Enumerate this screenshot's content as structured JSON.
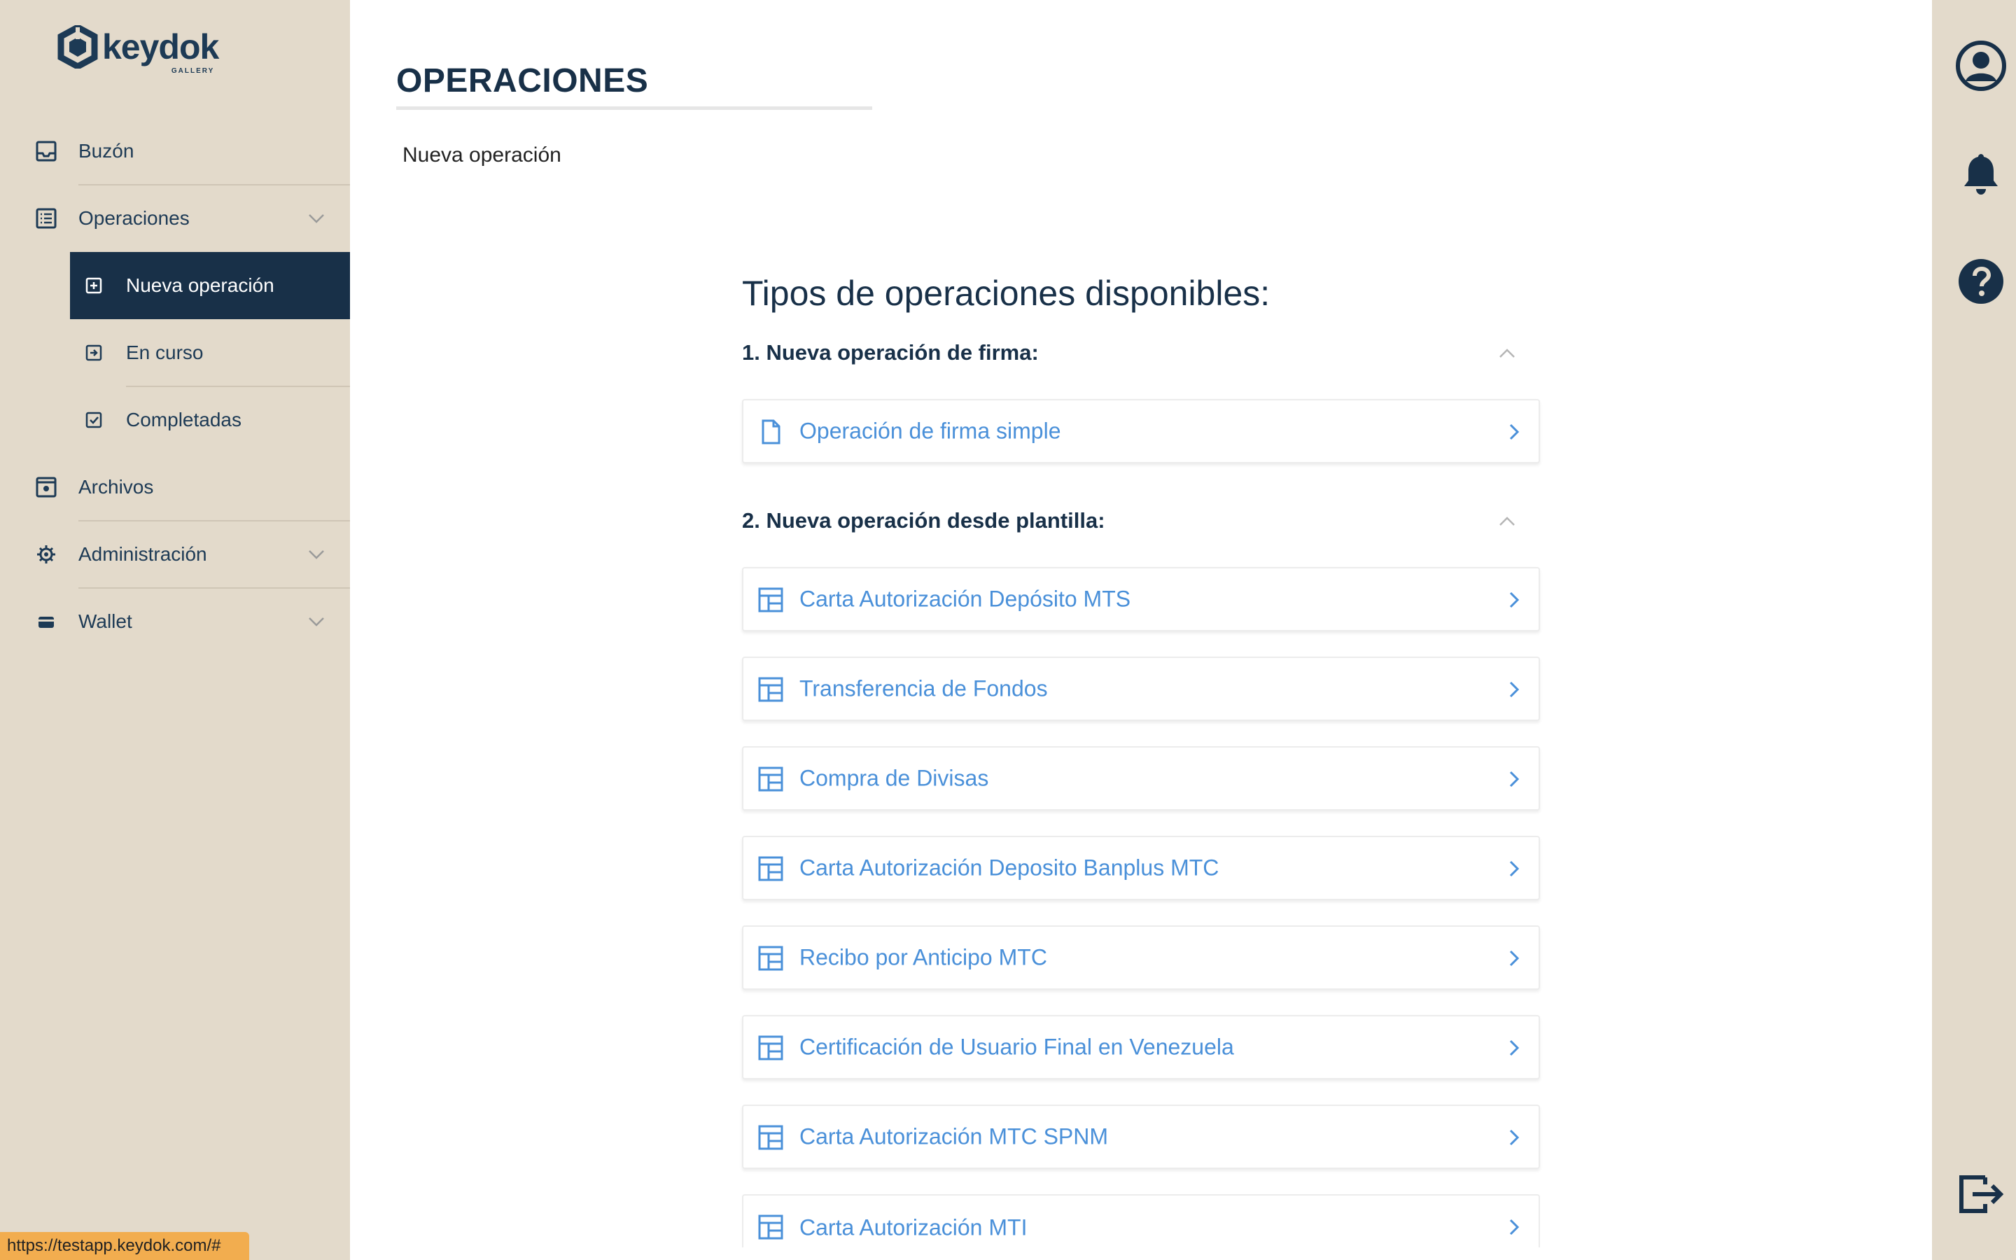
{
  "brand": {
    "name": "keydok",
    "tagline": "GALLERY"
  },
  "sidebar": {
    "items": [
      {
        "label": "Buzón",
        "icon": "inbox-icon"
      },
      {
        "label": "Operaciones",
        "icon": "list-icon",
        "expanded": true
      },
      {
        "label": "Archivos",
        "icon": "archive-icon"
      },
      {
        "label": "Administración",
        "icon": "gear-icon"
      },
      {
        "label": "Wallet",
        "icon": "wallet-icon"
      }
    ],
    "sub_items": [
      {
        "label": "Nueva operación",
        "icon": "plus-box-icon",
        "active": true
      },
      {
        "label": "En curso",
        "icon": "arrow-in-box-icon"
      },
      {
        "label": "Completadas",
        "icon": "check-box-icon"
      }
    ]
  },
  "status_bar": {
    "url": "https://testapp.keydok.com/#"
  },
  "header": {
    "title": "OPERACIONES",
    "breadcrumb": "Nueva operación"
  },
  "main": {
    "heading": "Tipos de operaciones disponibles:",
    "groups": [
      {
        "title": "1. Nueva operación de firma:",
        "items": [
          {
            "label": "Operación de firma simple",
            "icon": "document-icon"
          }
        ]
      },
      {
        "title": "2. Nueva operación desde plantilla:",
        "items": [
          {
            "label": "Carta Autorización Depósito MTS",
            "icon": "template-icon"
          },
          {
            "label": "Transferencia de Fondos",
            "icon": "template-icon"
          },
          {
            "label": "Compra de Divisas",
            "icon": "template-icon"
          },
          {
            "label": "Carta Autorización Deposito Banplus MTC",
            "icon": "template-icon"
          },
          {
            "label": "Recibo por Anticipo MTC",
            "icon": "template-icon"
          },
          {
            "label": "Certificación de Usuario Final en Venezuela",
            "icon": "template-icon"
          },
          {
            "label": "Carta Autorización MTC SPNM",
            "icon": "template-icon"
          },
          {
            "label": "Carta Autorización MTI",
            "icon": "template-icon"
          }
        ]
      }
    ]
  },
  "right_rail": {
    "icons": [
      "user-icon",
      "bell-icon",
      "help-icon",
      "logout-icon"
    ]
  },
  "colors": {
    "sidebar_bg": "#e3dacb",
    "active_bg": "#183048",
    "primary_text": "#1d3a55",
    "link_blue": "#4a90d9"
  }
}
